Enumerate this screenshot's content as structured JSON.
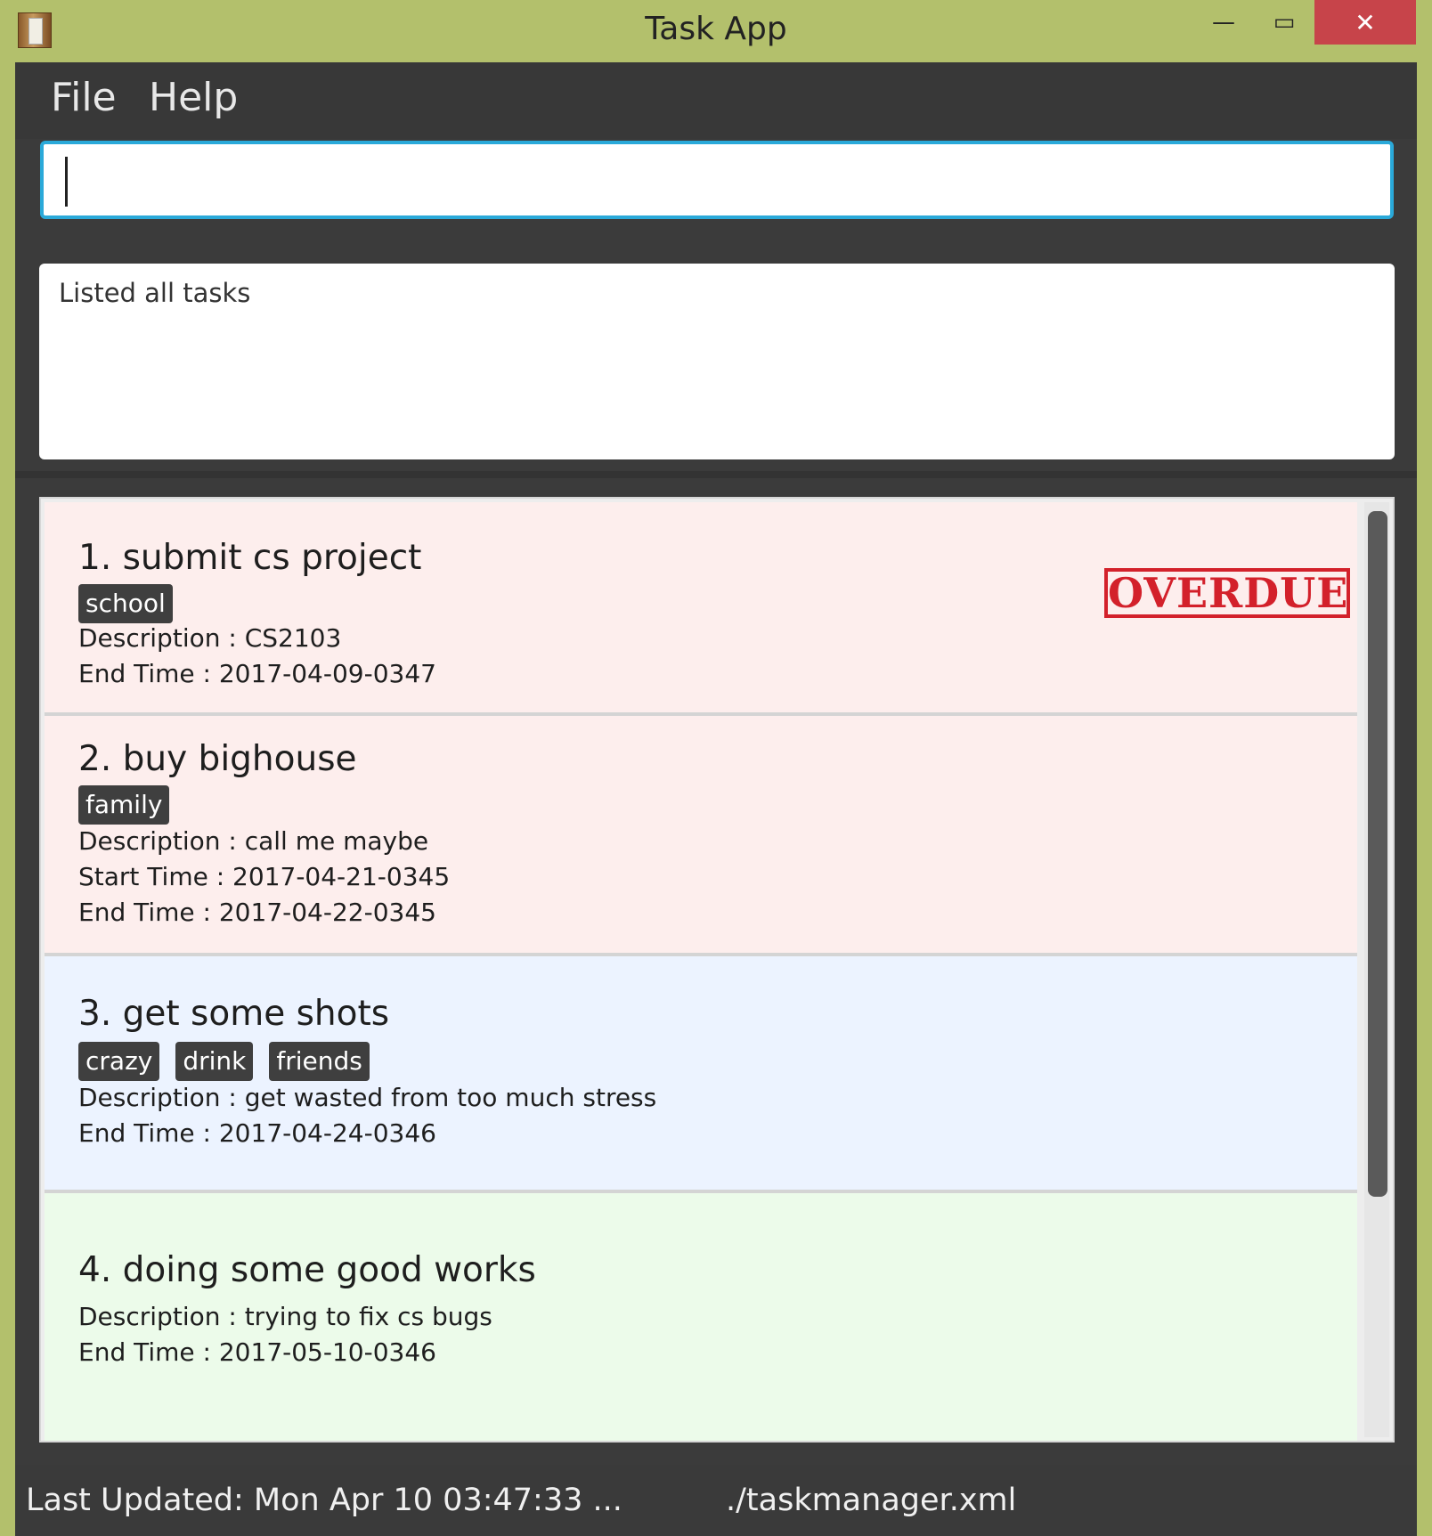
{
  "window": {
    "title": "Task App",
    "minimize_glyph": "—",
    "maximize_glyph": "▭",
    "close_glyph": "✕"
  },
  "menu": {
    "items": [
      {
        "label": "File"
      },
      {
        "label": "Help"
      }
    ]
  },
  "command": {
    "value": "",
    "placeholder": ""
  },
  "result": {
    "message": "Listed all tasks"
  },
  "tasks": [
    {
      "title": "1. submit cs project",
      "tags": [
        "school"
      ],
      "description": "Description : CS2103",
      "end_time": "End Time : 2017-04-09-0347",
      "stamp": "OVERDUE",
      "color": "#fdeeed"
    },
    {
      "title": "2. buy bighouse",
      "tags": [
        "family"
      ],
      "description": "Description : call me maybe",
      "start_time": "Start Time : 2017-04-21-0345",
      "end_time": "End Time : 2017-04-22-0345",
      "color": "#fdeeed"
    },
    {
      "title": "3. get some shots",
      "tags": [
        "crazy",
        "drink",
        "friends"
      ],
      "description": "Description : get wasted from too much stress",
      "end_time": "End Time : 2017-04-24-0346",
      "color": "#ecf3ff"
    },
    {
      "title": "4. doing some good works",
      "tags": [],
      "description": "Description : trying to fix cs bugs",
      "end_time": "End Time : 2017-05-10-0346",
      "color": "#ecfbea"
    }
  ],
  "status": {
    "last_updated": "Last Updated: Mon Apr 10 03:47:33 ...",
    "file_path": "./taskmanager.xml"
  },
  "colors": {
    "title_bar": "#b3c06c",
    "accent": "#2aa9d9",
    "close_button": "#c7444a",
    "overdue": "#d3212b"
  }
}
